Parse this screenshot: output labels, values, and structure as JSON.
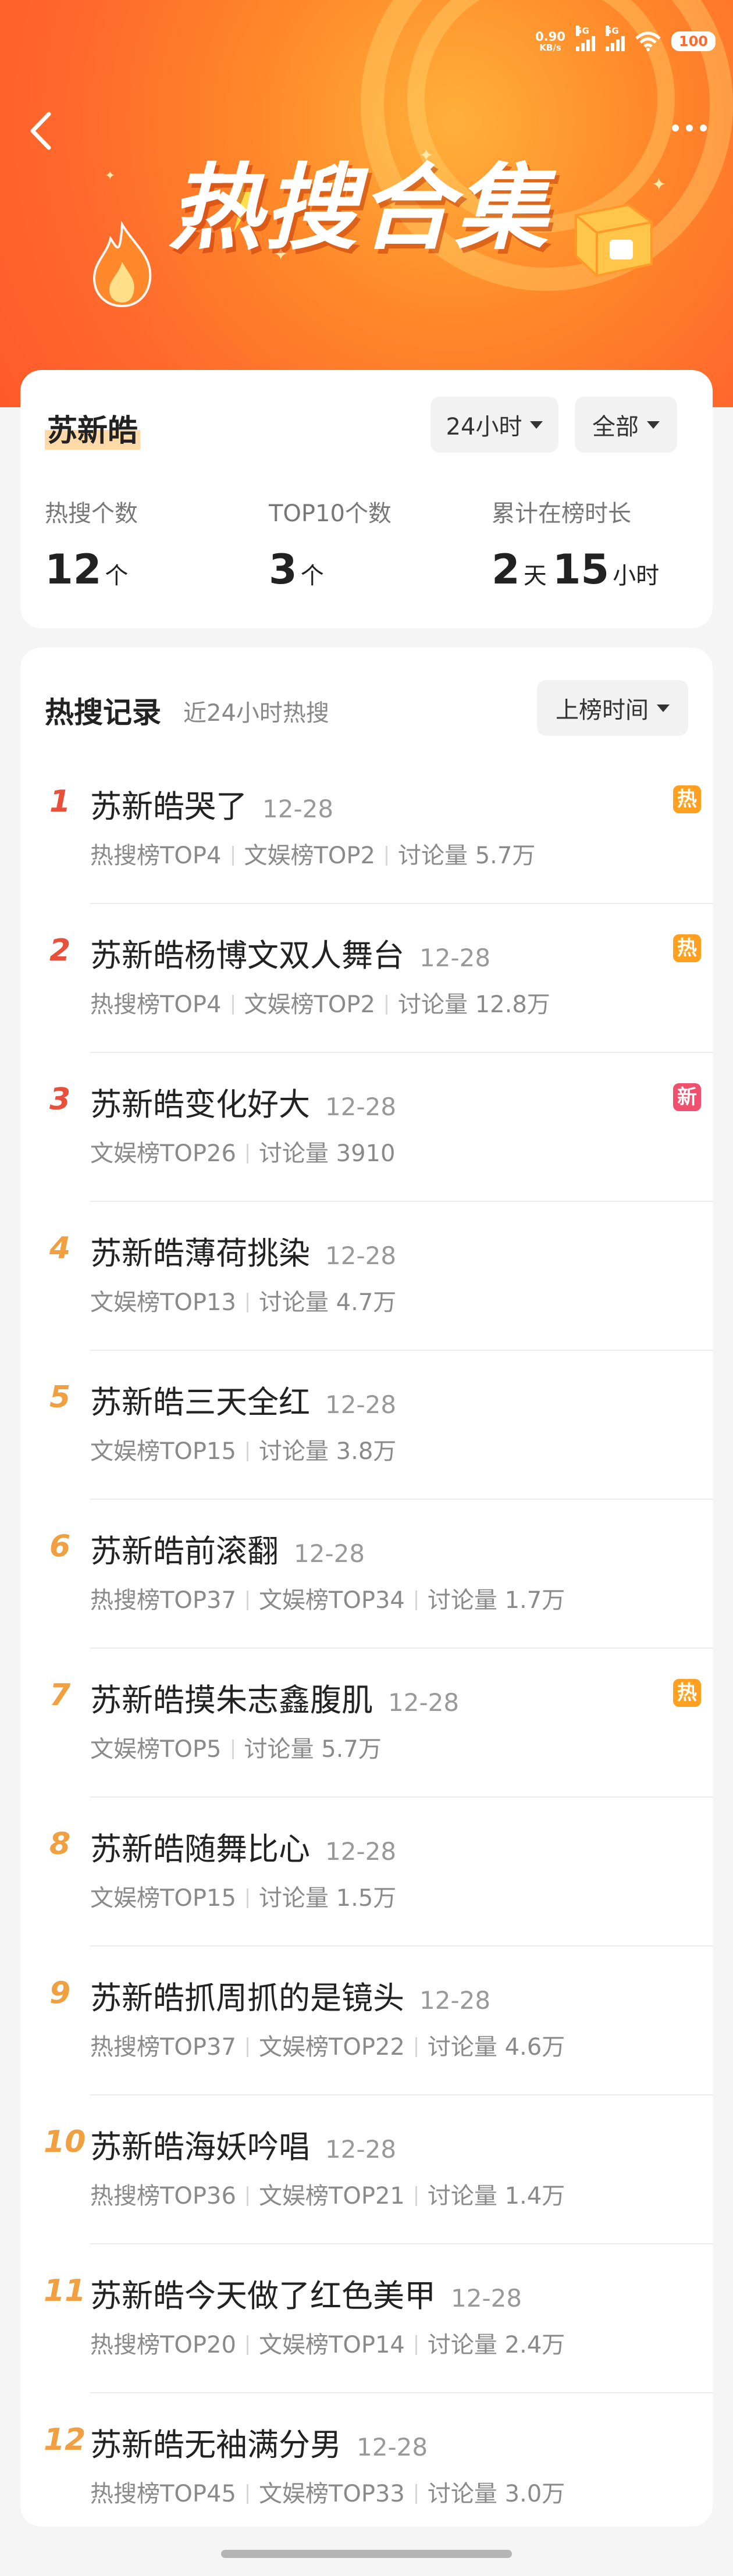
{
  "status_bar": {
    "speed_value": "0.90",
    "speed_unit": "KB/s",
    "net1": "5G",
    "net2": "5G",
    "battery": "100"
  },
  "hero": {
    "title": "热搜合集"
  },
  "summary": {
    "name": "苏新皓",
    "time_filter": "24小时",
    "scope_filter": "全部",
    "stats": [
      {
        "label": "热搜个数",
        "value": "12",
        "unit": "个"
      },
      {
        "label": "TOP10个数",
        "value": "3",
        "unit": "个"
      },
      {
        "label": "累计在榜时长",
        "days": "2",
        "days_unit": "天",
        "hours": "15",
        "hours_unit": "小时"
      }
    ]
  },
  "records": {
    "title": "热搜记录",
    "subtitle": "近24小时热搜",
    "sort": "上榜时间",
    "items": [
      {
        "rank": "1",
        "keyword": "苏新皓哭了",
        "date": "12-28",
        "meta": [
          "热搜榜TOP4",
          "文娱榜TOP2",
          "讨论量 5.7万"
        ],
        "badge": "热"
      },
      {
        "rank": "2",
        "keyword": "苏新皓杨博文双人舞台",
        "date": "12-28",
        "meta": [
          "热搜榜TOP4",
          "文娱榜TOP2",
          "讨论量 12.8万"
        ],
        "badge": "热"
      },
      {
        "rank": "3",
        "keyword": "苏新皓变化好大",
        "date": "12-28",
        "meta": [
          "文娱榜TOP26",
          "讨论量 3910"
        ],
        "badge": "新"
      },
      {
        "rank": "4",
        "keyword": "苏新皓薄荷挑染",
        "date": "12-28",
        "meta": [
          "文娱榜TOP13",
          "讨论量 4.7万"
        ],
        "badge": ""
      },
      {
        "rank": "5",
        "keyword": "苏新皓三天全红",
        "date": "12-28",
        "meta": [
          "文娱榜TOP15",
          "讨论量 3.8万"
        ],
        "badge": ""
      },
      {
        "rank": "6",
        "keyword": "苏新皓前滚翻",
        "date": "12-28",
        "meta": [
          "热搜榜TOP37",
          "文娱榜TOP34",
          "讨论量 1.7万"
        ],
        "badge": ""
      },
      {
        "rank": "7",
        "keyword": "苏新皓摸朱志鑫腹肌",
        "date": "12-28",
        "meta": [
          "文娱榜TOP5",
          "讨论量 5.7万"
        ],
        "badge": "热"
      },
      {
        "rank": "8",
        "keyword": "苏新皓随舞比心",
        "date": "12-28",
        "meta": [
          "文娱榜TOP15",
          "讨论量 1.5万"
        ],
        "badge": ""
      },
      {
        "rank": "9",
        "keyword": "苏新皓抓周抓的是镜头",
        "date": "12-28",
        "meta": [
          "热搜榜TOP37",
          "文娱榜TOP22",
          "讨论量 4.6万"
        ],
        "badge": ""
      },
      {
        "rank": "10",
        "keyword": "苏新皓海妖吟唱",
        "date": "12-28",
        "meta": [
          "热搜榜TOP36",
          "文娱榜TOP21",
          "讨论量 1.4万"
        ],
        "badge": ""
      },
      {
        "rank": "11",
        "keyword": "苏新皓今天做了红色美甲",
        "date": "12-28",
        "meta": [
          "热搜榜TOP20",
          "文娱榜TOP14",
          "讨论量 2.4万"
        ],
        "badge": ""
      },
      {
        "rank": "12",
        "keyword": "苏新皓无袖满分男",
        "date": "12-28",
        "meta": [
          "热搜榜TOP45",
          "文娱榜TOP33",
          "讨论量 3.0万"
        ],
        "badge": ""
      }
    ]
  },
  "colors": {
    "rank_top3": "#e8503c",
    "rank_other": "#f0a040",
    "badge_hot": "#ffa020",
    "badge_new": "#f0506e",
    "accent": "#ff6a2c"
  }
}
